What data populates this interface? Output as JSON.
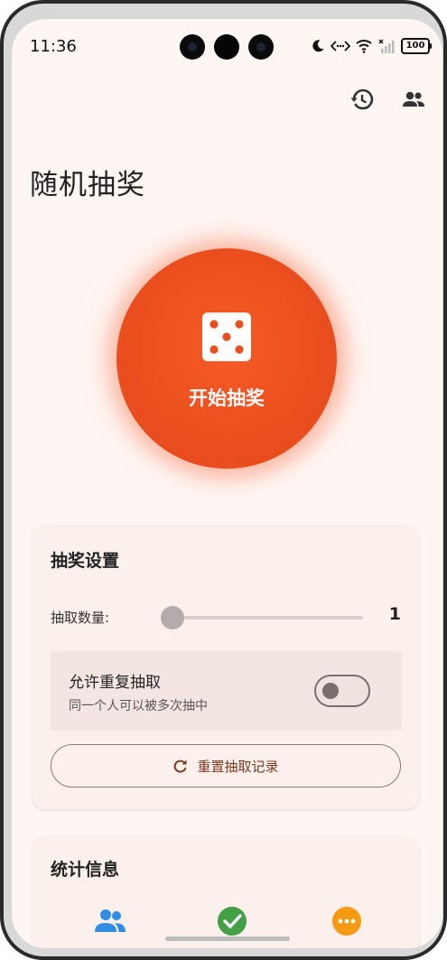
{
  "status_bar": {
    "time": "11:36",
    "battery": "100",
    "icons": [
      "moon-icon",
      "data-transfer-icon",
      "wifi-icon",
      "cellular-signal-icon",
      "battery-icon"
    ]
  },
  "top_actions": [
    "history-icon",
    "people-icon"
  ],
  "page": {
    "title": "随机抽奖"
  },
  "draw": {
    "label": "开始抽奖",
    "icon": "dice-icon"
  },
  "settings": {
    "title": "抽奖设置",
    "count_label": "抽取数量:",
    "count_value": "1",
    "count": 1,
    "repeat_title": "允许重复抽取",
    "repeat_subtitle": "同一个人可以被多次抽中",
    "repeat_enabled": false,
    "reset_label": "重置抽取记录",
    "reset_icon": "refresh-icon"
  },
  "stats": {
    "title": "统计信息",
    "icons": [
      "people-icon",
      "check-circle-icon",
      "more-circle-icon"
    ]
  },
  "colors": {
    "background": "#fef6f3",
    "accent": "#ef5222",
    "blue": "#2f8de4",
    "green": "#43a047",
    "orange": "#f59a12"
  }
}
